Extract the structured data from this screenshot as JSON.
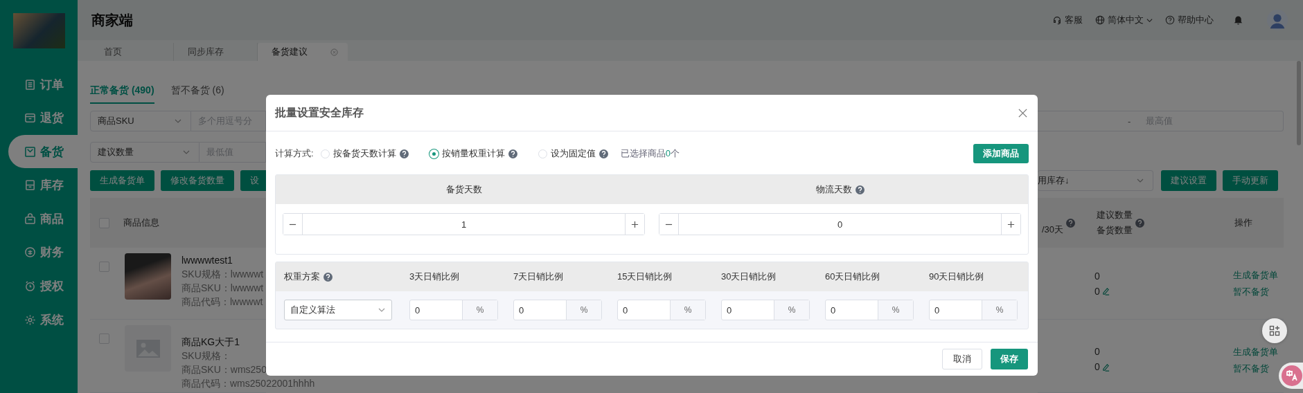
{
  "sidebar": {
    "items": [
      {
        "label": "订单",
        "selected": false
      },
      {
        "label": "退货",
        "selected": false
      },
      {
        "label": "备货",
        "selected": true
      },
      {
        "label": "库存",
        "selected": false
      },
      {
        "label": "商品",
        "selected": false
      },
      {
        "label": "财务",
        "selected": false
      },
      {
        "label": "授权",
        "selected": false
      },
      {
        "label": "系统",
        "selected": false
      }
    ]
  },
  "header": {
    "title": "商家端",
    "links": [
      {
        "kind": "service",
        "label": "客服"
      },
      {
        "kind": "language",
        "label": "简体中文"
      },
      {
        "kind": "help",
        "label": "帮助中心"
      }
    ]
  },
  "page_tabs": [
    {
      "label": "首页",
      "selected": false,
      "closable": false
    },
    {
      "label": "同步库存",
      "selected": false,
      "closable": false
    },
    {
      "label": "备货建议",
      "selected": true,
      "closable": true
    }
  ],
  "content_tabs": [
    {
      "label": "正常备货 (490)",
      "selected": true
    },
    {
      "label": "暂不备货 (6)",
      "selected": false
    }
  ],
  "filters": {
    "sku_select": "商品SKU",
    "sku_placeholder": "多个用逗号分",
    "qty_select": "建议数量",
    "min_placeholder": "最低值",
    "range_separator": "-",
    "max_placeholder": "最高值"
  },
  "actions": {
    "left": [
      "生成备货单",
      "修改备货数量",
      "设"
    ],
    "sort_select": "用库存↓",
    "right": [
      "建议设置",
      "手动更新"
    ]
  },
  "table": {
    "checked": false,
    "info_column": "商品信息",
    "right_columns": [
      {
        "lines": [
          "/30天"
        ],
        "help": true
      },
      {
        "lines": [
          "建议数量",
          "备货数量"
        ],
        "help": true
      },
      {
        "lines": [
          "操作"
        ],
        "help": false
      }
    ],
    "rows": [
      {
        "checked": false,
        "name": "lwwwwtest1",
        "details": [
          "SKU规格：lwwwwt",
          "商品SKU：lwwwwt",
          "商品代码：lwwwwt"
        ],
        "suggested": "0",
        "stock": "0",
        "links": [
          "生成备货单",
          "暂不备货"
        ]
      },
      {
        "checked": false,
        "name": "商品KG大于1",
        "details": [
          "SKU规格：",
          "商品SKU：wms250",
          "商品代码：wms25022001hhhh"
        ],
        "suggested": "0",
        "stock": "0",
        "links": [
          "生成备货单",
          "暂不备货"
        ]
      }
    ]
  },
  "modal": {
    "title": "批量设置安全库存",
    "method_label": "计算方式:",
    "methods": [
      {
        "label": "按备货天数计算",
        "selected": false
      },
      {
        "label": "按销量权重计算",
        "selected": true
      },
      {
        "label": "设为固定值",
        "selected": false
      }
    ],
    "selected_count": {
      "prefix": "已选择商品",
      "count": "0",
      "suffix": "个"
    },
    "add_button": "添加商品",
    "days": [
      {
        "label": "备货天数",
        "help": false,
        "value": "1"
      },
      {
        "label": "物流天数",
        "help": true,
        "value": "0"
      }
    ],
    "weights": {
      "scheme_label": "权重方案",
      "scheme_value": "自定义算法",
      "columns": [
        {
          "label": "3天日销比例",
          "value": "0",
          "unit": "%"
        },
        {
          "label": "7天日销比例",
          "value": "0",
          "unit": "%"
        },
        {
          "label": "15天日销比例",
          "value": "0",
          "unit": "%"
        },
        {
          "label": "30天日销比例",
          "value": "0",
          "unit": "%"
        },
        {
          "label": "60天日销比例",
          "value": "0",
          "unit": "%"
        },
        {
          "label": "90天日销比例",
          "value": "0",
          "unit": "%"
        }
      ]
    },
    "cancel": "取消",
    "save": "保存"
  }
}
